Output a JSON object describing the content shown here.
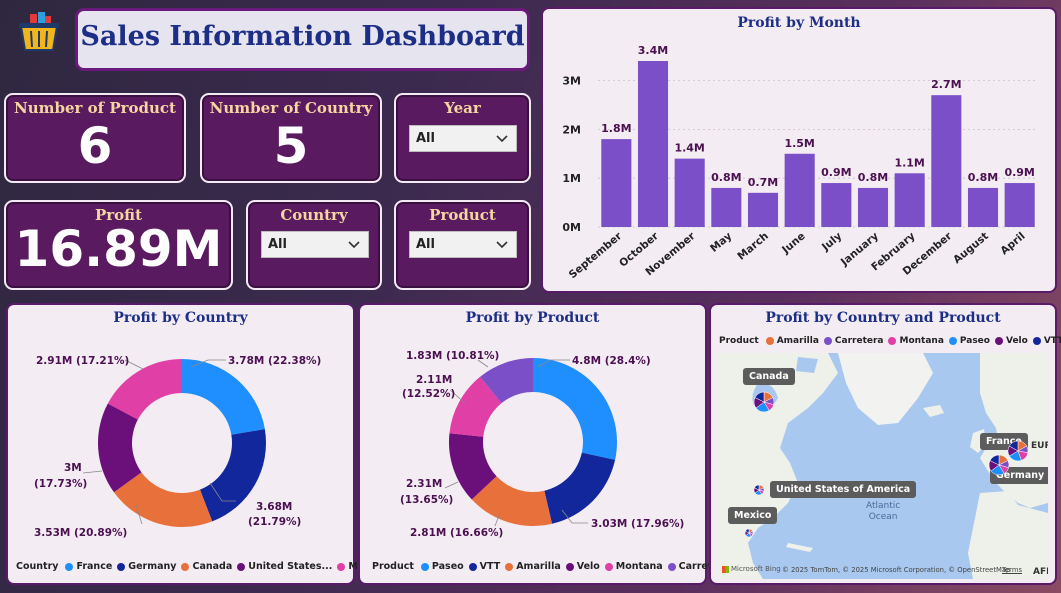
{
  "header": {
    "title": "Sales Information Dashboard",
    "icon": "shopping-basket-icon"
  },
  "kpis": {
    "num_product": {
      "label": "Number of Product",
      "value": "6"
    },
    "num_country": {
      "label": "Number of Country",
      "value": "5"
    },
    "profit": {
      "label": "Profit",
      "value": "16.89M"
    }
  },
  "filters": {
    "year": {
      "label": "Year",
      "value": "All"
    },
    "country": {
      "label": "Country",
      "value": "All"
    },
    "product": {
      "label": "Product",
      "value": "All"
    }
  },
  "colors": {
    "bar": "#7a4fc8",
    "france": "#1f8fff",
    "germany": "#12279c",
    "canada": "#e8703a",
    "usa": "#6b0f7a",
    "mexico": "#e03fa6",
    "paseo": "#1f8fff",
    "vtt": "#12279c",
    "amarilla": "#e8703a",
    "velo": "#6b0f7a",
    "montana": "#e03fa6",
    "carretera": "#7a4fc8"
  },
  "profit_by_month": {
    "title": "Profit by Month",
    "y_ticks": [
      "0M",
      "1M",
      "2M",
      "3M"
    ]
  },
  "profit_by_country": {
    "title": "Profit by Country",
    "legend_title": "Country",
    "legend": [
      "France",
      "Germany",
      "Canada",
      "United States...",
      "Mexico"
    ],
    "labels": {
      "france": "3.78M (22.38%)",
      "germany_a": "3.68M",
      "germany_b": "(21.79%)",
      "canada": "3.53M (20.89%)",
      "usa_a": "3M",
      "usa_b": "(17.73%)",
      "mexico": "2.91M (17.21%)"
    }
  },
  "profit_by_product": {
    "title": "Profit by Product",
    "legend_title": "Product",
    "legend": [
      "Paseo",
      "VTT",
      "Amarilla",
      "Velo",
      "Montana",
      "Carretera"
    ],
    "labels": {
      "paseo": "4.8M (28.4%)",
      "vtt": "3.03M (17.96%)",
      "amarilla": "2.81M (16.66%)",
      "velo_a": "2.31M",
      "velo_b": "(13.65%)",
      "montana_a": "2.11M",
      "montana_b": "(12.52%)",
      "carretera": "1.83M (10.81%)"
    }
  },
  "map": {
    "title": "Profit by Country and Product",
    "legend_title": "Product",
    "legend": [
      "Amarilla",
      "Carretera",
      "Montana",
      "Paseo",
      "Velo",
      "VTT"
    ],
    "labels": {
      "canada": "Canada",
      "france": "France",
      "germany": "Germany",
      "usa": "United States of America",
      "mexico": "Mexico",
      "ocean_a": "Atlantic",
      "ocean_b": "Ocean",
      "eur": "EUR",
      "afr": "AFI"
    },
    "attribution": "© 2025 TomTom, © 2025 Microsoft Corporation, © OpenStreetMap",
    "terms": "Terms",
    "bing": "Microsoft Bing"
  },
  "chart_data": [
    {
      "type": "bar",
      "title": "Profit by Month",
      "categories": [
        "September",
        "October",
        "November",
        "May",
        "March",
        "June",
        "July",
        "January",
        "February",
        "December",
        "August",
        "April"
      ],
      "values": [
        1.8,
        3.4,
        1.4,
        0.8,
        0.7,
        1.5,
        0.9,
        0.8,
        1.1,
        2.7,
        0.8,
        0.9
      ],
      "data_labels": [
        "1.8M",
        "3.4M",
        "1.4M",
        "0.8M",
        "0.7M",
        "1.5M",
        "0.9M",
        "0.8M",
        "1.1M",
        "2.7M",
        "0.8M",
        "0.9M"
      ],
      "ylim": [
        0,
        3.4
      ],
      "grid": true
    },
    {
      "type": "pie",
      "title": "Profit by Country",
      "categories": [
        "France",
        "Germany",
        "Canada",
        "United States of America",
        "Mexico"
      ],
      "values": [
        3.78,
        3.68,
        3.53,
        3.0,
        2.91
      ],
      "percent": [
        22.38,
        21.79,
        20.89,
        17.73,
        17.21
      ]
    },
    {
      "type": "pie",
      "title": "Profit by Product",
      "categories": [
        "Paseo",
        "VTT",
        "Amarilla",
        "Velo",
        "Montana",
        "Carretera"
      ],
      "values": [
        4.8,
        3.03,
        2.81,
        2.31,
        2.11,
        1.83
      ],
      "percent": [
        28.4,
        17.96,
        16.66,
        13.65,
        12.52,
        10.81
      ]
    }
  ]
}
